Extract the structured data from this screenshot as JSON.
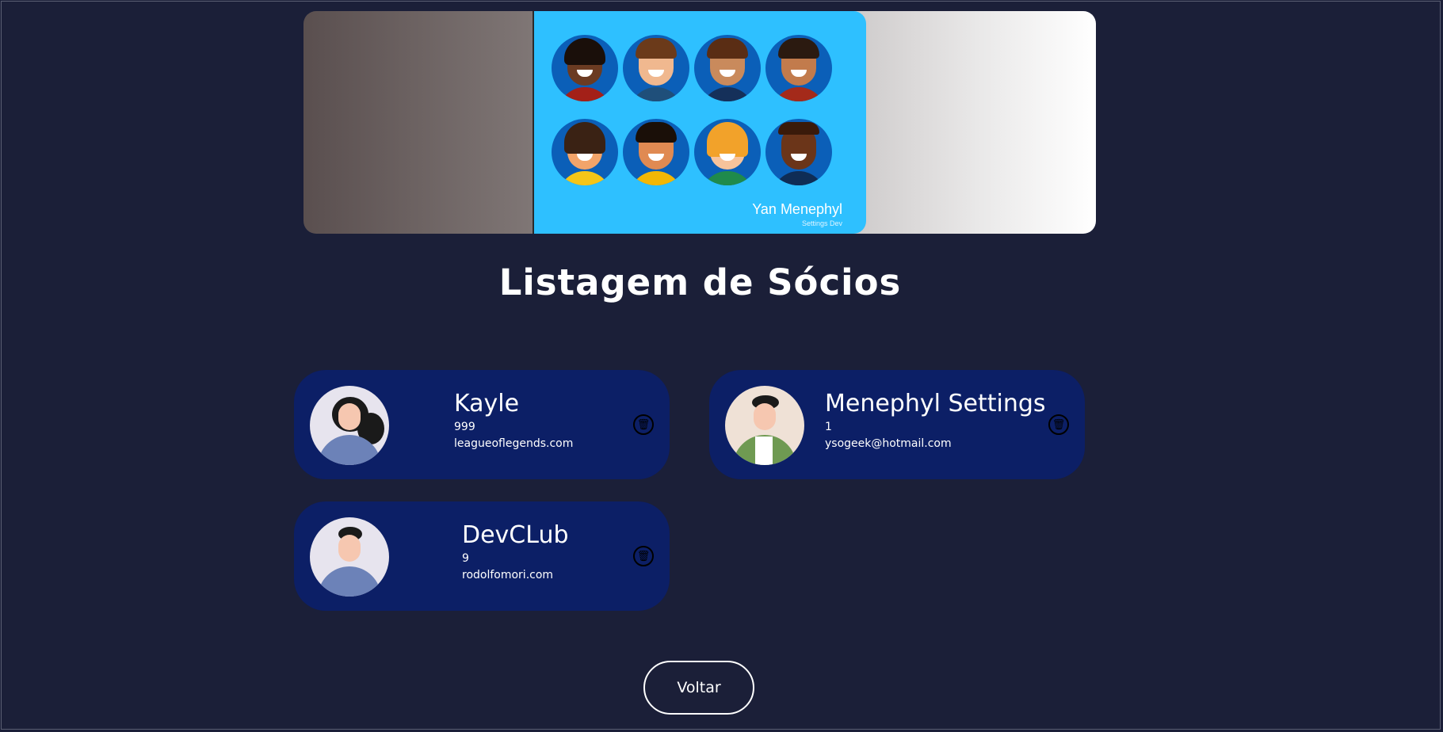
{
  "banner": {
    "caption": "Yan Menephyl",
    "subcaption": "Settings Dev"
  },
  "page_title": "Listagem de Sócios",
  "members": [
    {
      "name": "Kayle",
      "age": "999",
      "email": "leagueoflegends.com",
      "avatar": "woman-headset-avatar"
    },
    {
      "name": "Menephyl Settings",
      "age": "1",
      "email": "ysogeek@hotmail.com",
      "avatar": "man-green-jacket-avatar"
    },
    {
      "name": "DevCLub",
      "age": "9",
      "email": "rodolfomori.com",
      "avatar": "man-thinking-avatar"
    }
  ],
  "icons": {
    "delete": "trash-icon"
  },
  "back_button": "Voltar",
  "colors": {
    "background": "#1b1f38",
    "card": "#0c1f66",
    "banner_blue": "#2ec0ff"
  }
}
